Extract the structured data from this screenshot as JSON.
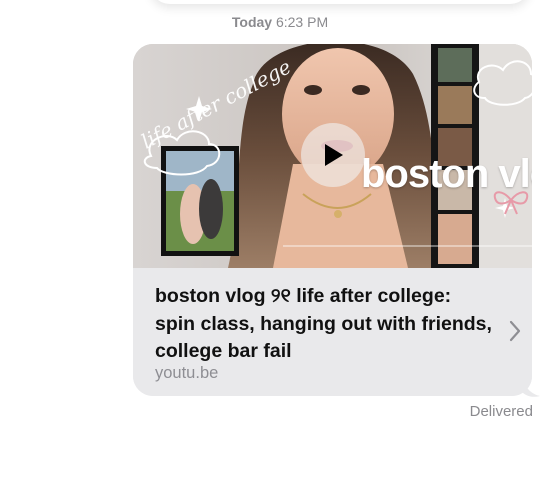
{
  "conversation": {
    "timestamp_day": "Today",
    "timestamp_time": "6:23 PM",
    "status": "Delivered"
  },
  "link_preview": {
    "title": "boston vlog ୨୧ life after college: spin class, hanging out with friends, college bar fail",
    "domain": "youtu.be",
    "thumbnail": {
      "overlay_title": "boston vlog",
      "script_text": "life after college"
    }
  },
  "icons": {
    "play": "play-icon",
    "chevron": "chevron-right-icon",
    "bow": "bow-icon"
  },
  "colors": {
    "bubble": "#e9e9eb",
    "meta_text": "#8a8a8e",
    "title_text": "#111111",
    "domain_text": "#8e8e93"
  }
}
